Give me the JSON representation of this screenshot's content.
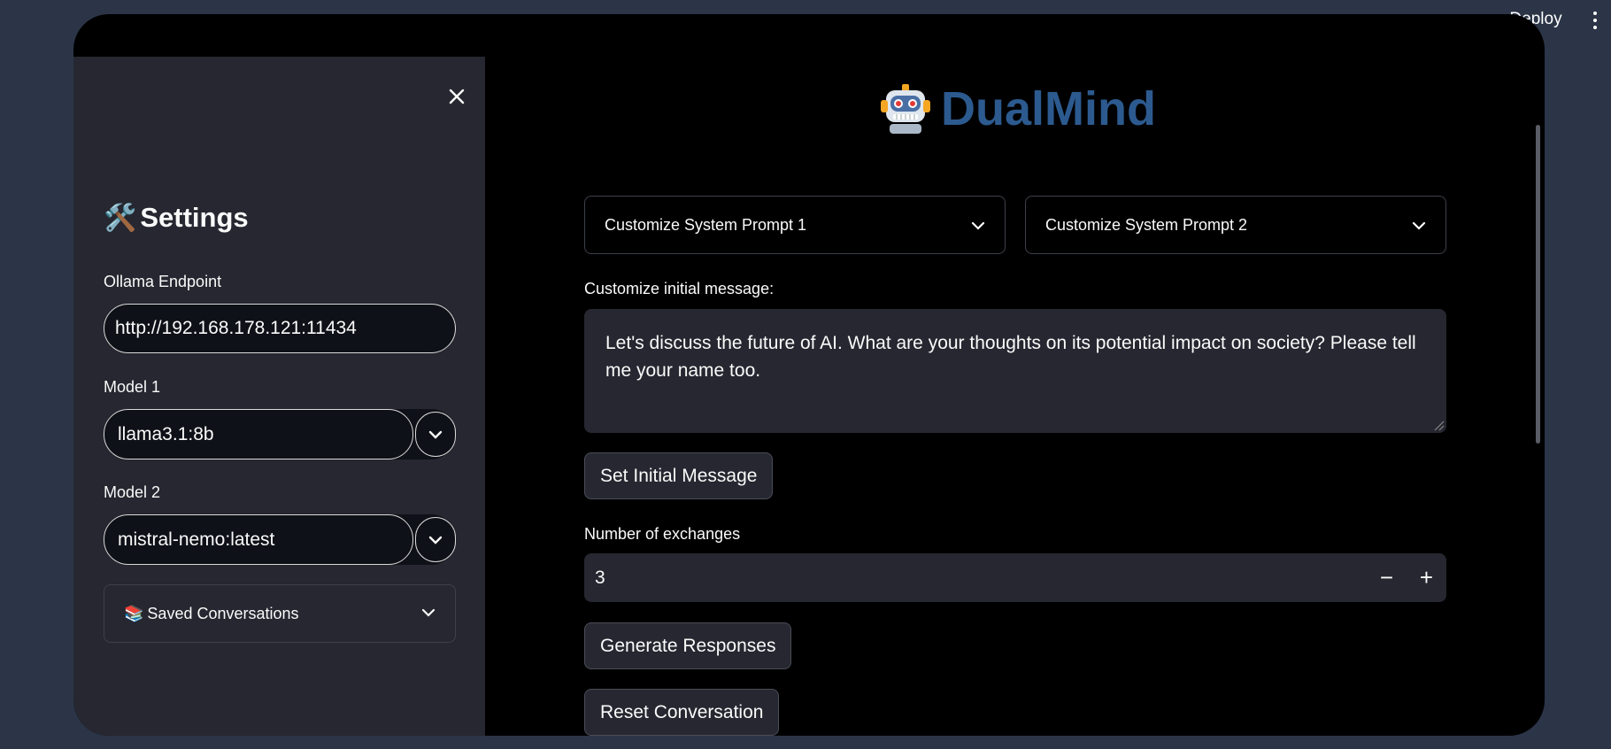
{
  "topbar": {
    "deploy_label": "Deploy",
    "menu_icon": "more-vertical-icon"
  },
  "sidebar": {
    "title": "Settings",
    "title_icon": "🛠️",
    "endpoint": {
      "label": "Ollama Endpoint",
      "value": "http://192.168.178.121:11434"
    },
    "model1": {
      "label": "Model 1",
      "value": "llama3.1:8b"
    },
    "model2": {
      "label": "Model 2",
      "value": "mistral-nemo:latest"
    },
    "saved": {
      "icon": "📚",
      "label": "Saved Conversations"
    }
  },
  "main": {
    "title": "DualMind",
    "prompt1_label": "Customize System Prompt 1",
    "prompt2_label": "Customize System Prompt 2",
    "initial_message_label": "Customize initial message:",
    "initial_message_value": "Let's discuss the future of AI. What are your thoughts on its potential impact on society? Please tell me your name too.",
    "set_initial_button": "Set Initial Message",
    "exchanges_label": "Number of exchanges",
    "exchanges_value": "3",
    "minus_label": "−",
    "plus_label": "+",
    "generate_button": "Generate Responses",
    "reset_button": "Reset Conversation"
  },
  "colors": {
    "accent_title": "#2c5a8f",
    "sidebar_bg": "#262730",
    "main_bg": "#000000",
    "page_bg": "#2b3547"
  }
}
